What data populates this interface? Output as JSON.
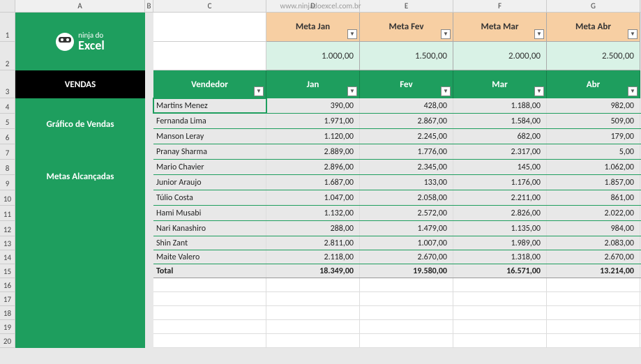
{
  "watermark": "www.ninjadoexcel.com.br",
  "columns": [
    "A",
    "B",
    "C",
    "D",
    "E",
    "F",
    "G"
  ],
  "sidebar": {
    "logo_l1": "ninja do",
    "logo_l2": "Excel",
    "nav": [
      "VENDAS",
      "Gráfico de Vendas",
      "Metas Alcançadas"
    ]
  },
  "meta_headers": [
    "Meta Jan",
    "Meta Fev",
    "Meta Mar",
    "Meta Abr"
  ],
  "meta_values": [
    "1.000,00",
    "1.500,00",
    "2.000,00",
    "2.500,00"
  ],
  "table_headers": [
    "Vendedor",
    "Jan",
    "Fev",
    "Mar",
    "Abr"
  ],
  "rows": [
    {
      "vend": "Martins Menez",
      "m": [
        "390,00",
        "428,00",
        "1.188,00",
        "982,00"
      ]
    },
    {
      "vend": "Fernanda Lima",
      "m": [
        "1.971,00",
        "2.867,00",
        "1.584,00",
        "509,00"
      ]
    },
    {
      "vend": "Manson Leray",
      "m": [
        "1.120,00",
        "2.245,00",
        "682,00",
        "179,00"
      ]
    },
    {
      "vend": "Pranay Sharma",
      "m": [
        "2.889,00",
        "1.776,00",
        "2.317,00",
        "5,00"
      ]
    },
    {
      "vend": "Mario Chavier",
      "m": [
        "2.896,00",
        "2.345,00",
        "145,00",
        "1.062,00"
      ]
    },
    {
      "vend": "Junior Araujo",
      "m": [
        "1.687,00",
        "133,00",
        "1.176,00",
        "1.857,00"
      ]
    },
    {
      "vend": "Túlio Costa",
      "m": [
        "1.047,00",
        "2.058,00",
        "2.211,00",
        "861,00"
      ]
    },
    {
      "vend": "Hami Musabi",
      "m": [
        "1.132,00",
        "2.572,00",
        "2.826,00",
        "2.022,00"
      ]
    },
    {
      "vend": "Nari Kanashiro",
      "m": [
        "288,00",
        "1.479,00",
        "1.135,00",
        "984,00"
      ]
    },
    {
      "vend": "Shin Zant",
      "m": [
        "2.811,00",
        "1.007,00",
        "1.989,00",
        "2.083,00"
      ]
    },
    {
      "vend": "Maite Valero",
      "m": [
        "2.118,00",
        "2.670,00",
        "1.318,00",
        "2.670,00"
      ]
    }
  ],
  "total": {
    "label": "Total",
    "m": [
      "18.349,00",
      "19.580,00",
      "16.571,00",
      "13.214,00"
    ]
  },
  "row_heights": {
    "1": 42,
    "2": 41,
    "3": 40,
    "4": 22,
    "5": 22,
    "6": 22,
    "7": 22,
    "8": 22,
    "9": 22,
    "10": 22,
    "11": 22,
    "12": 22,
    "13": 20,
    "14": 20,
    "15": 20,
    "16": 20,
    "17": 20,
    "18": 20,
    "19": 20,
    "20": 20
  }
}
